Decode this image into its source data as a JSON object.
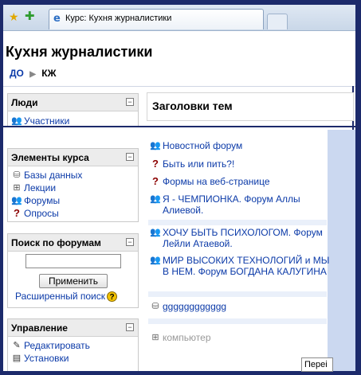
{
  "browser": {
    "tab_title": "Курс: Кухня журналистики"
  },
  "page": {
    "title": "Кухня журналистики",
    "breadcrumb": [
      "ДО",
      "КЖ"
    ]
  },
  "blocks": {
    "people": {
      "title": "Люди",
      "items": [
        {
          "icon": "participants-icon",
          "label": "Участники"
        }
      ]
    },
    "course_elements": {
      "title": "Элементы курса",
      "items": [
        {
          "icon": "database-icon",
          "label": "Базы данных"
        },
        {
          "icon": "lesson-icon",
          "label": "Лекции"
        },
        {
          "icon": "forum-icon",
          "label": "Форумы"
        },
        {
          "icon": "question-icon",
          "label": "Опросы"
        }
      ]
    },
    "forum_search": {
      "title": "Поиск по форумам",
      "input_value": "",
      "apply_label": "Применить",
      "advanced_label": "Расширенный поиск"
    },
    "management": {
      "title": "Управление",
      "items": [
        {
          "icon": "edit-icon",
          "label": "Редактировать"
        },
        {
          "icon": "settings-icon",
          "label": "Установки"
        }
      ]
    }
  },
  "main": {
    "topics_header": "Заголовки тем",
    "activities": [
      {
        "icon": "forum-icon",
        "label": "Новостной форум"
      },
      {
        "icon": "question-icon",
        "label": "Быть или пить?!"
      },
      {
        "icon": "question-icon",
        "label": "Формы на веб-странице"
      },
      {
        "icon": "forum-icon",
        "label": "Я - ЧЕМПИОНКА. Форум Аллы Алиевой."
      },
      {
        "icon": "forum-icon",
        "label": "ХОЧУ БЫТЬ ПСИХОЛОГОМ. Форум Лейли Атаевой."
      },
      {
        "icon": "forum-icon",
        "label": "МИР ВЫСОКИХ ТЕХНОЛОГИЙ и МЫ В НЕМ. Форум БОГДАНА КАЛУГИНА"
      },
      {
        "icon": "database-icon",
        "label": "gggggggggggg"
      },
      {
        "icon": "lesson-icon",
        "label": "компьютер"
      }
    ],
    "jump_select_value": "Переі"
  },
  "colors": {
    "frame": "#1c2a6b",
    "link": "#0b3aa8",
    "gutter": "#cbd8f0"
  }
}
